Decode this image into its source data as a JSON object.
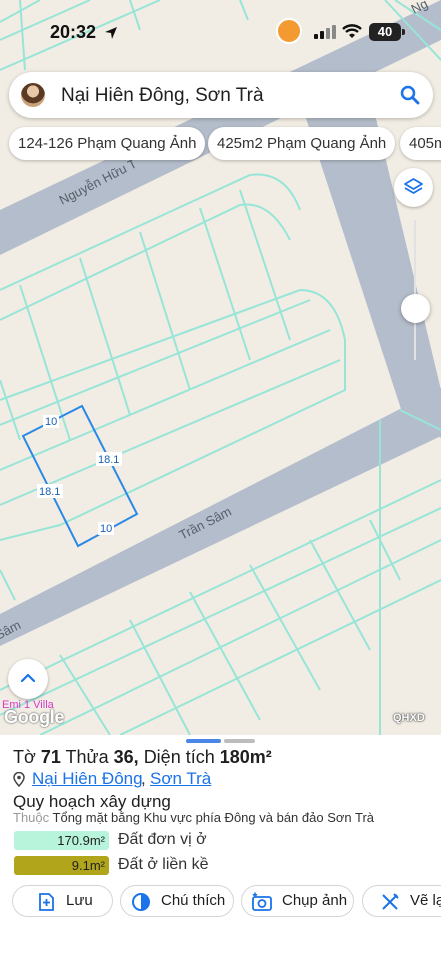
{
  "status_bar": {
    "time": "20:32",
    "battery": "40"
  },
  "search": {
    "query": "Nại Hiên Đông, Sơn Trà"
  },
  "chips": [
    "124-126 Phạm Quang Ảnh",
    "425m2 Phạm Quang Ảnh",
    "405m"
  ],
  "map": {
    "street_labels": [
      "Nguyễn Hữu T",
      "Trần Sâm",
      "Sâm",
      "Ng"
    ],
    "parcel_dimensions": [
      "10",
      "18.1",
      "18.1",
      "10"
    ],
    "poi_label": "Emi 1 Villa",
    "google_logo": "Google",
    "qhxd_label": "QHXD",
    "colors": {
      "land": "#f1ede4",
      "road": "#b4bdcb",
      "parcel_line": "#98e5d8",
      "selection": "#2b88e6"
    }
  },
  "info": {
    "to_label": "Tờ",
    "to_value": "71",
    "thua_label": "Thửa",
    "thua_value": "36,",
    "area_label": "Diện tích",
    "area_value": "180m²",
    "ward": "Nại Hiên Đông",
    "district": "Sơn Trà",
    "section_title": "Quy hoạch xây dựng",
    "belongs_label": "Thuộc",
    "belongs_value": "Tổng mặt bằng Khu vực phía Đông và bán đảo Sơn Trà",
    "land_use": [
      {
        "value": "170.9m²",
        "label": "Đất đơn vị ở",
        "color": "#b8f3dc",
        "share": 0.95
      },
      {
        "value": "9.1m²",
        "label": "Đất ở liền kề",
        "color": "#b1a51c",
        "share": 0.05
      }
    ]
  },
  "actions": {
    "save": "Lưu",
    "legend": "Chú thích",
    "capture": "Chụp ảnh",
    "draw": "Vẽ lạ"
  }
}
